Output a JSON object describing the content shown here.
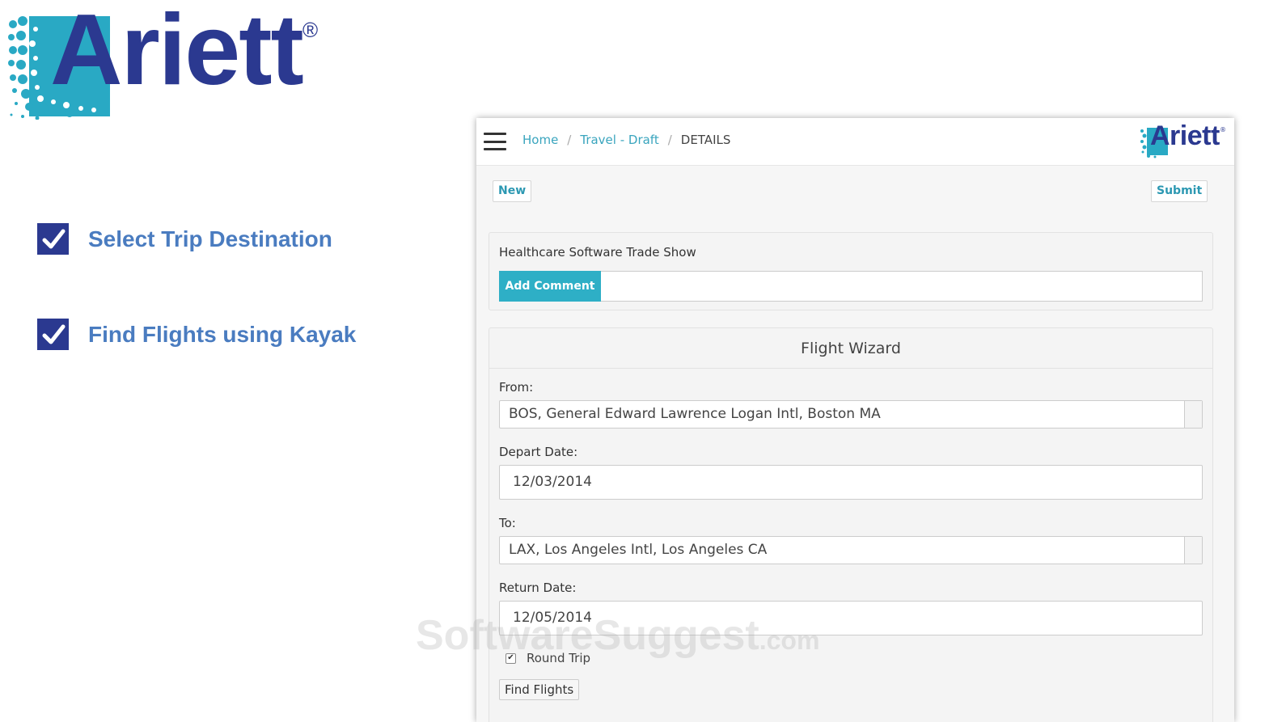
{
  "brand": {
    "logo_text": "Ariett",
    "registered_mark": "®",
    "primary_color": "#2b3990",
    "dot_color": "#29a9c4"
  },
  "checklist": [
    {
      "label": "Select Trip Destination",
      "checked": true
    },
    {
      "label": "Find Flights using Kayak",
      "checked": true
    }
  ],
  "app": {
    "breadcrumb": {
      "home": "Home",
      "separator": "/",
      "travel": "Travel - Draft",
      "current": "DETAILS"
    },
    "toolbar": {
      "new_label": "New",
      "submit_label": "Submit"
    },
    "trip": {
      "title": "Healthcare Software Trade Show",
      "add_comment_label": "Add Comment",
      "comment_value": ""
    },
    "wizard": {
      "title": "Flight Wizard",
      "from_label": "From:",
      "from_value": "BOS, General Edward Lawrence Logan Intl, Boston MA",
      "depart_label": "Depart Date:",
      "depart_value": "12/03/2014",
      "to_label": "To:",
      "to_value": "LAX, Los Angeles Intl, Los Angeles CA",
      "return_label": "Return Date:",
      "return_value": "12/05/2014",
      "round_trip_label": "Round Trip",
      "round_trip_checked": true,
      "find_flights_label": "Find Flights"
    }
  },
  "watermark": {
    "main": "SoftwareSuggest",
    "suffix": ".com"
  }
}
